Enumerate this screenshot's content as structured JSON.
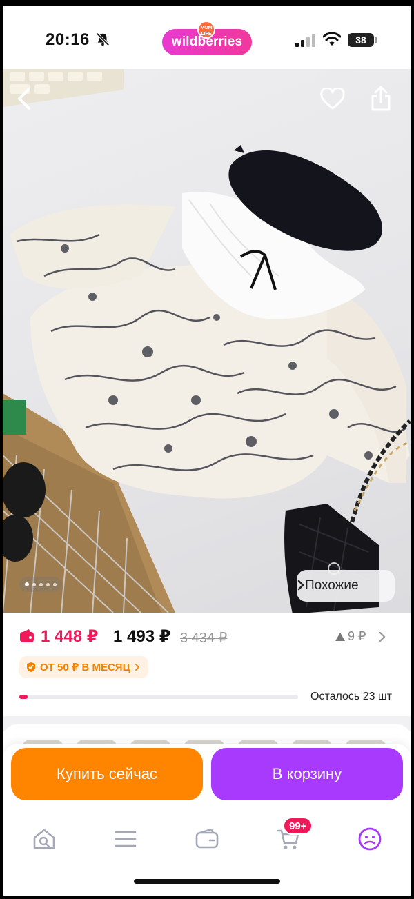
{
  "status_bar": {
    "time": "20:16",
    "app_badge": "wildberries",
    "badge_overlay": "MOM LIFE",
    "battery": "38"
  },
  "product_image": {
    "similar_label": "Похожие",
    "slides_total": 5,
    "slide_active": 1
  },
  "price": {
    "wallet_price": "1 448 ₽",
    "price": "1 493 ₽",
    "old_price": "3 434 ₽",
    "price_change": "9 ₽",
    "installment": "ОТ 50 ₽ В МЕСЯЦ",
    "stock_left": "Осталось 23 шт",
    "stock_progress": 0.03
  },
  "actions": {
    "buy_now": "Купить сейчас",
    "add_to_cart": "В корзину"
  },
  "tabbar": {
    "cart_badge": "99+",
    "items": [
      "home-icon",
      "catalog-icon",
      "wallet-icon",
      "cart-icon",
      "profile-icon"
    ]
  },
  "colors": {
    "brand_pink": "#f0195a",
    "brand_purple": "#a73afd",
    "accent_orange": "#ff8400"
  }
}
